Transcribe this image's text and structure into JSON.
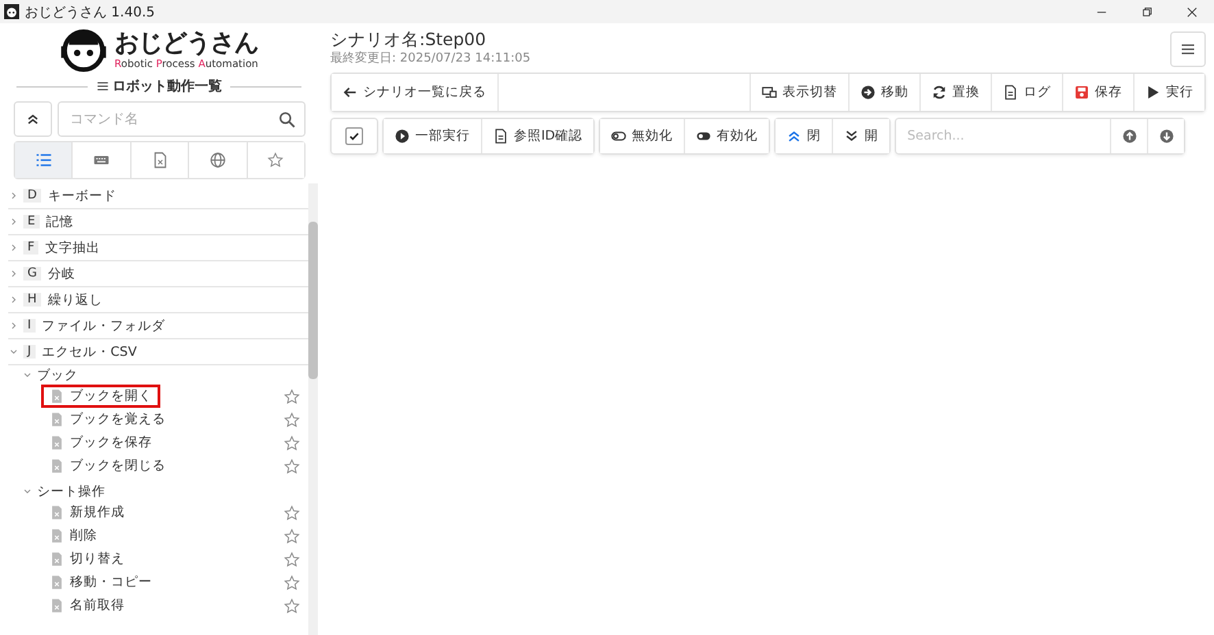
{
  "window": {
    "title": "おじどうさん 1.40.5"
  },
  "logo": {
    "name": "おじどうさん",
    "tagline": [
      {
        "text": "R",
        "accent": true
      },
      {
        "text": "obotic ",
        "accent": false
      },
      {
        "text": "P",
        "accent": true
      },
      {
        "text": "rocess ",
        "accent": false
      },
      {
        "text": "A",
        "accent": true
      },
      {
        "text": "utomation",
        "accent": false
      }
    ]
  },
  "sidebar": {
    "heading": "ロボット動作一覧",
    "search": {
      "placeholder": "コマンド名"
    },
    "tabs": [
      {
        "kind": "list",
        "selected": true
      },
      {
        "kind": "keyboard",
        "selected": false
      },
      {
        "kind": "file",
        "selected": false
      },
      {
        "kind": "globe",
        "selected": false
      },
      {
        "kind": "star",
        "selected": false
      }
    ],
    "tree": [
      {
        "letter": "D",
        "label": "キーボード",
        "expanded": false
      },
      {
        "letter": "E",
        "label": "記憶",
        "expanded": false
      },
      {
        "letter": "F",
        "label": "文字抽出",
        "expanded": false
      },
      {
        "letter": "G",
        "label": "分岐",
        "expanded": false
      },
      {
        "letter": "H",
        "label": "繰り返し",
        "expanded": false
      },
      {
        "letter": "I",
        "label": "ファイル・フォルダ",
        "expanded": false
      },
      {
        "letter": "J",
        "label": "エクセル・CSV",
        "expanded": true,
        "children": [
          {
            "label": "ブック",
            "expanded": true,
            "children": [
              {
                "label": "ブックを開く",
                "favorite": false,
                "highlighted": true
              },
              {
                "label": "ブックを覚える",
                "favorite": false,
                "highlighted": false
              },
              {
                "label": "ブックを保存",
                "favorite": false,
                "highlighted": false
              },
              {
                "label": "ブックを閉じる",
                "favorite": false,
                "highlighted": false
              }
            ]
          },
          {
            "label": "シート操作",
            "expanded": true,
            "children": [
              {
                "label": "新規作成",
                "favorite": false,
                "highlighted": false
              },
              {
                "label": "削除",
                "favorite": false,
                "highlighted": false
              },
              {
                "label": "切り替え",
                "favorite": false,
                "highlighted": false
              },
              {
                "label": "移動・コピー",
                "favorite": false,
                "highlighted": false
              },
              {
                "label": "名前取得",
                "favorite": false,
                "highlighted": false
              }
            ]
          }
        ]
      }
    ]
  },
  "main": {
    "scenario_name": "シナリオ名:Step00",
    "modified": "最終変更日: 2025/07/23 14:11:05",
    "back_button": "シナリオ一覧に戻る",
    "toolbar": [
      {
        "kind": "display",
        "label": "表示切替"
      },
      {
        "kind": "move",
        "label": "移動"
      },
      {
        "kind": "replace",
        "label": "置換"
      },
      {
        "kind": "log",
        "label": "ログ"
      },
      {
        "kind": "save",
        "label": "保存"
      },
      {
        "kind": "run",
        "label": "実行"
      }
    ],
    "select_all": {
      "checked": true
    },
    "action_groups": [
      [
        {
          "kind": "partial-run",
          "label": "一部実行"
        },
        {
          "kind": "ref-id",
          "label": "参照ID確認"
        }
      ],
      [
        {
          "kind": "disable",
          "label": "無効化"
        },
        {
          "kind": "enable",
          "label": "有効化"
        }
      ],
      [
        {
          "kind": "collapse",
          "label": "閉"
        },
        {
          "kind": "expand",
          "label": "開"
        }
      ]
    ],
    "search": {
      "placeholder": "Search..."
    }
  }
}
